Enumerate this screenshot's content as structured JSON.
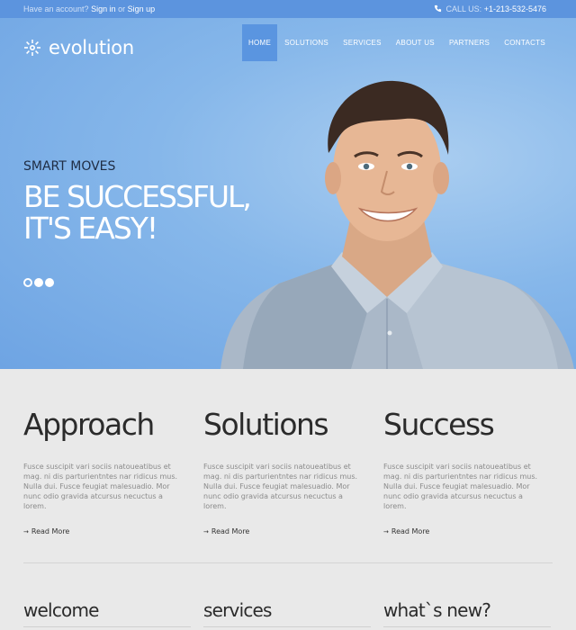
{
  "topbar": {
    "account_prompt": "Have an account?",
    "sign_in": "Sign in",
    "or": "or",
    "sign_up": "Sign up",
    "call_label": "CALL US:",
    "phone": "+1-213-532-5476"
  },
  "logo": {
    "name": "evolution"
  },
  "nav": {
    "items": [
      "HOME",
      "SOLUTIONS",
      "SERVICES",
      "ABOUT US",
      "PARTNERS",
      "CONTACTS"
    ],
    "active_index": 0
  },
  "hero": {
    "kicker": "SMART MOVES",
    "headline_line1": "BE SUCCESSFUL,",
    "headline_line2": "IT'S EASY!",
    "slide_count": 3,
    "active_slide": 0
  },
  "features": [
    {
      "title": "Approach",
      "text": "Fusce suscipit vari sociis natoueatibus et mag. ni dis parturientntes nar ridicus mus. Nulla dui. Fusce feugiat malesuadio. Mor nunc odio gravida atcursus necuctus a lorem.",
      "link": "Read More"
    },
    {
      "title": "Solutions",
      "text": "Fusce suscipit vari sociis natoueatibus et mag. ni dis parturientntes nar ridicus mus. Nulla dui. Fusce feugiat malesuadio. Mor nunc odio gravida atcursus necuctus a lorem.",
      "link": "Read More"
    },
    {
      "title": "Success",
      "text": "Fusce suscipit vari sociis natoueatibus et mag. ni dis parturientntes nar ridicus mus. Nulla dui. Fusce feugiat malesuadio. Mor nunc odio gravida atcursus necuctus a lorem.",
      "link": "Read More"
    }
  ],
  "subheadings": [
    "welcome",
    "services",
    "what`s new?"
  ],
  "colors": {
    "topbar": "#5c94de",
    "nav_active": "#5a95e0",
    "hero_blue": "#86b7ea"
  },
  "icons": {
    "phone": "phone-icon",
    "logo": "logo-mark-icon",
    "arrow": "arrow-right-icon"
  }
}
